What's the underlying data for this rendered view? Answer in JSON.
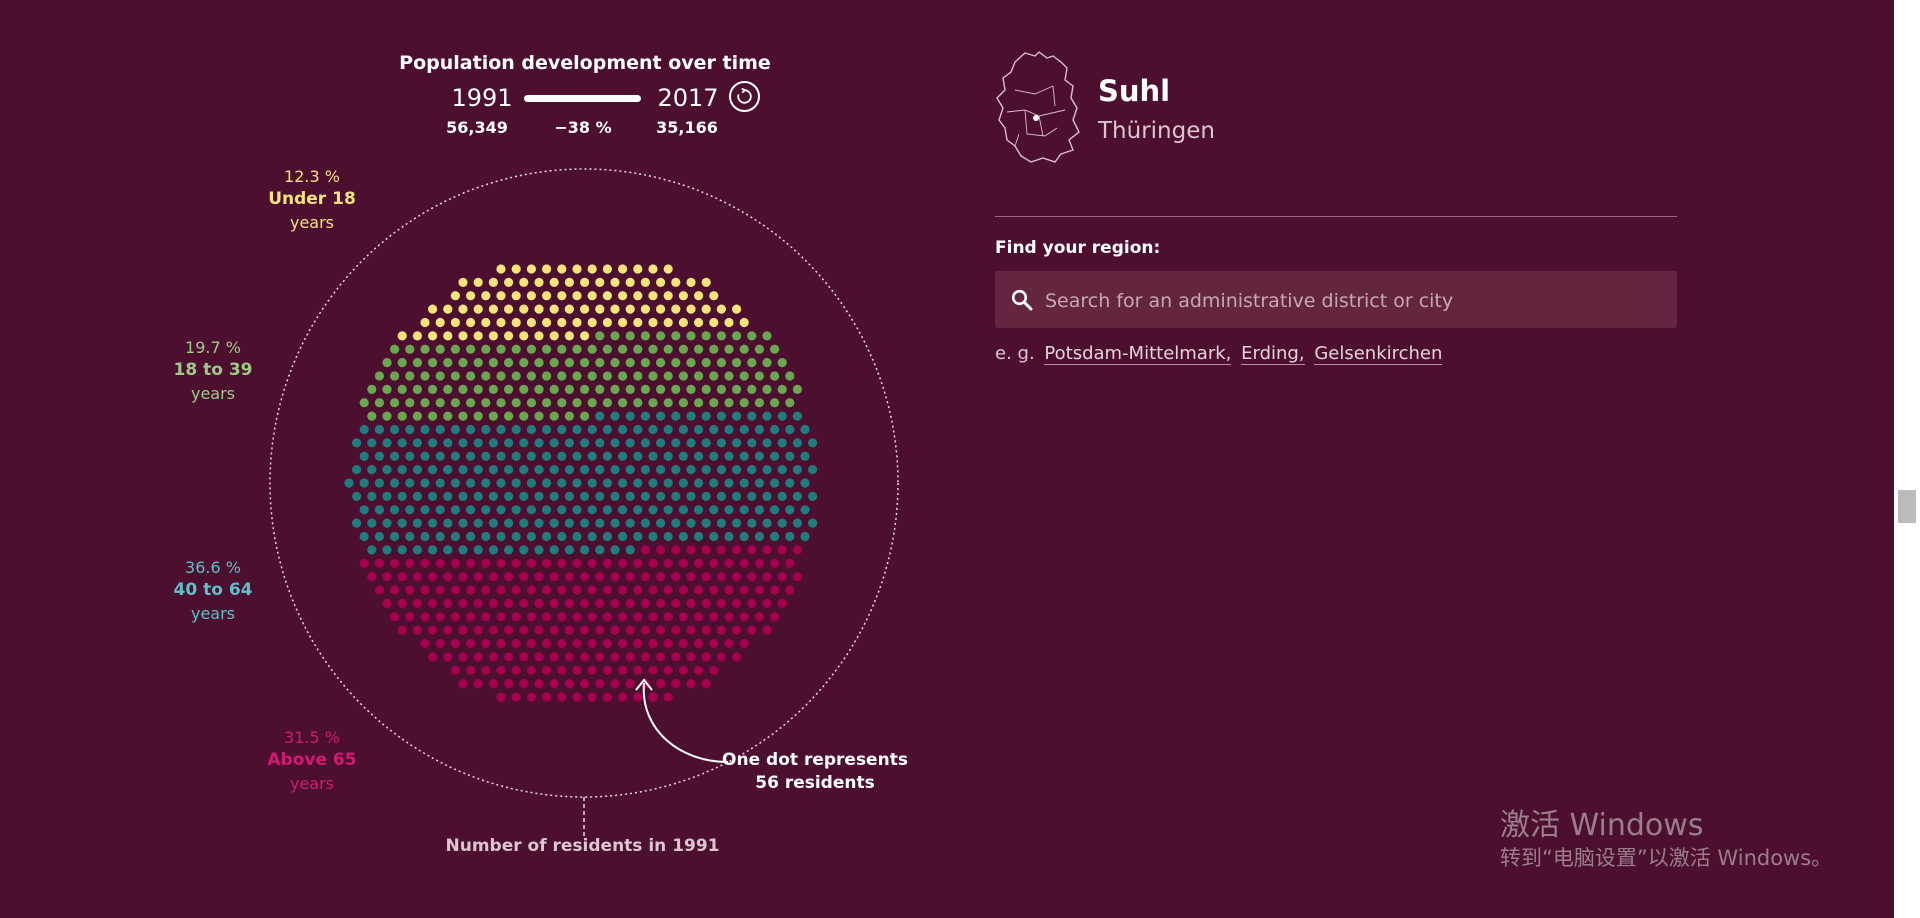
{
  "timeline": {
    "title": "Population development over time",
    "year_start": "1991",
    "year_end": "2017",
    "population_start": "56,349",
    "population_end": "35,166",
    "change_percent": "−38 %"
  },
  "age_groups": [
    {
      "key": "under18",
      "percent": "12.3 %",
      "name": "Under 18",
      "unit": "years",
      "color": "#f6e37a",
      "share": 12.3
    },
    {
      "key": "18to39",
      "percent": "19.7 %",
      "name": "18 to 39",
      "unit": "years",
      "color": "#6aa84f",
      "share": 19.7
    },
    {
      "key": "40to64",
      "percent": "36.6 %",
      "name": "40 to 64",
      "unit": "years",
      "color": "#1f7d7e",
      "share": 36.6
    },
    {
      "key": "above65",
      "percent": "31.5 %",
      "name": "Above 65",
      "unit": "years",
      "color": "#a7004f",
      "share": 31.5
    }
  ],
  "chart": {
    "dot_note_line1": "One dot represents",
    "dot_note_line2": "56 residents",
    "residents_label": "Number of residents in 1991"
  },
  "region": {
    "name": "Suhl",
    "state": "Thüringen",
    "map_icon": "germany-map-icon"
  },
  "search": {
    "label": "Find your region:",
    "placeholder": "Search for an administrative district or city",
    "examples_prefix": "e. g.",
    "examples": [
      "Potsdam-Mittelmark,",
      "Erding,",
      "Gelsenkirchen"
    ]
  },
  "watermark": {
    "title": "激活 Windows",
    "subtitle": "转到“电脑设置”以激活 Windows。"
  }
}
